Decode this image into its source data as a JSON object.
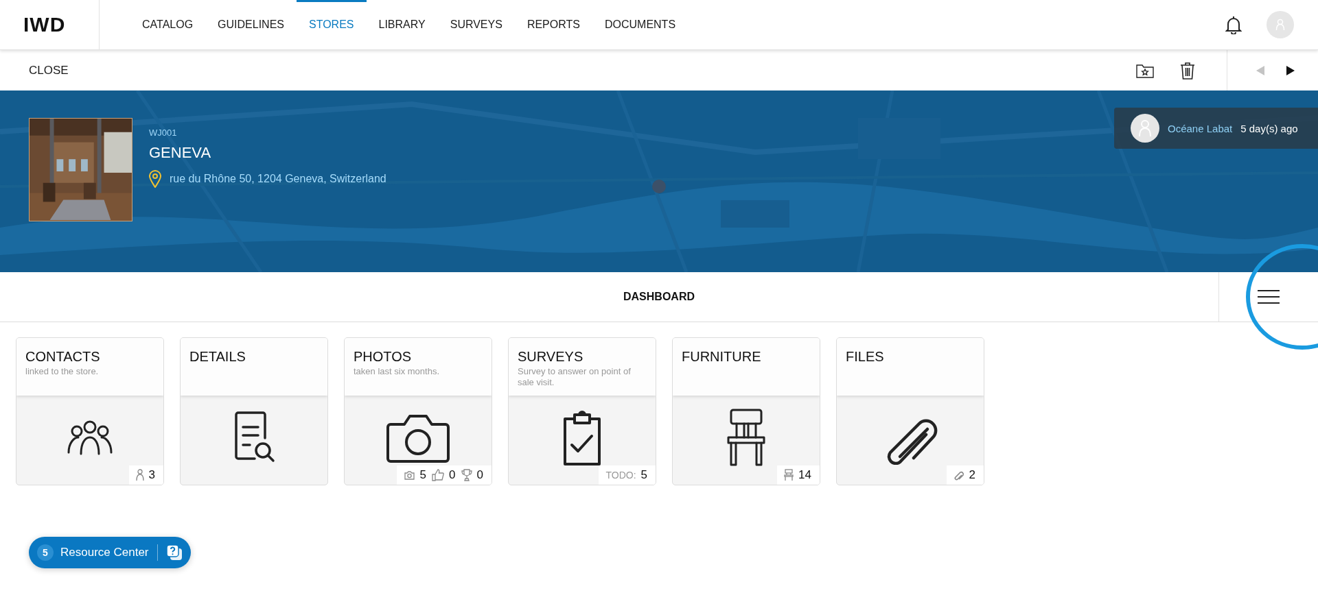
{
  "nav": {
    "logo": "IWD",
    "items": [
      {
        "label": "CATALOG",
        "selected": false
      },
      {
        "label": "GUIDELINES",
        "selected": false
      },
      {
        "label": "STORES",
        "selected": true
      },
      {
        "label": "LIBRARY",
        "selected": false
      },
      {
        "label": "SURVEYS",
        "selected": false
      },
      {
        "label": "REPORTS",
        "selected": false
      },
      {
        "label": "DOCUMENTS",
        "selected": false
      }
    ]
  },
  "toolbar": {
    "close": "CLOSE",
    "prev_disabled": true,
    "next_disabled": false
  },
  "store": {
    "code": "WJ001",
    "name": "GENEVA",
    "address": "rue du Rhône 50, 1204 Geneva, Switzerland"
  },
  "activity": {
    "user": "Océane Labat",
    "time": "5 day(s) ago"
  },
  "dashboard": {
    "title": "DASHBOARD",
    "menu_highlighted": true
  },
  "cards": [
    {
      "kind": "contacts",
      "title": "CONTACTS",
      "subtitle": "linked to the store.",
      "stats": [
        {
          "kind": "person",
          "value": "3"
        }
      ]
    },
    {
      "kind": "details",
      "title": "DETAILS"
    },
    {
      "kind": "photos",
      "title": "PHOTOS",
      "subtitle": "taken last six months.",
      "stats": [
        {
          "kind": "camera",
          "value": "5"
        },
        {
          "kind": "like",
          "value": "0"
        },
        {
          "kind": "trophy",
          "value": "0"
        }
      ]
    },
    {
      "kind": "surveys",
      "title": "SURVEYS",
      "subtitle": "Survey to answer on point of sale visit.",
      "stats": [
        {
          "kind": "label",
          "label": "TODO:",
          "value": "5"
        }
      ]
    },
    {
      "kind": "furniture",
      "title": "FURNITURE",
      "stats": [
        {
          "kind": "chair",
          "value": "14"
        }
      ]
    },
    {
      "kind": "files",
      "title": "FILES",
      "stats": [
        {
          "kind": "clip",
          "value": "2"
        }
      ]
    }
  ],
  "resource_center": {
    "count": "5",
    "label": "Resource Center"
  }
}
